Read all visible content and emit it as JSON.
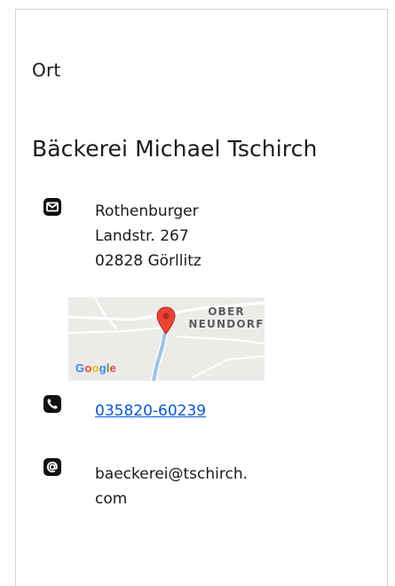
{
  "section": {
    "heading": "Ort"
  },
  "business": {
    "name": "Bäckerei Michael Tschirch"
  },
  "address": {
    "icon": "envelope-icon",
    "lines": [
      "Rothenburger",
      "Landstr. 267",
      "02828 Görllitz"
    ]
  },
  "map": {
    "place_label_lines": [
      "OBER",
      "NEUNDORF"
    ],
    "provider": "Google",
    "marker_color": "#ea4335"
  },
  "phone": {
    "icon": "phone-icon",
    "number": "035820-60239",
    "link_color": "#0b57d0"
  },
  "email": {
    "icon": "at-sign-icon",
    "lines": [
      "baeckerei@tschirch.",
      "com"
    ]
  }
}
